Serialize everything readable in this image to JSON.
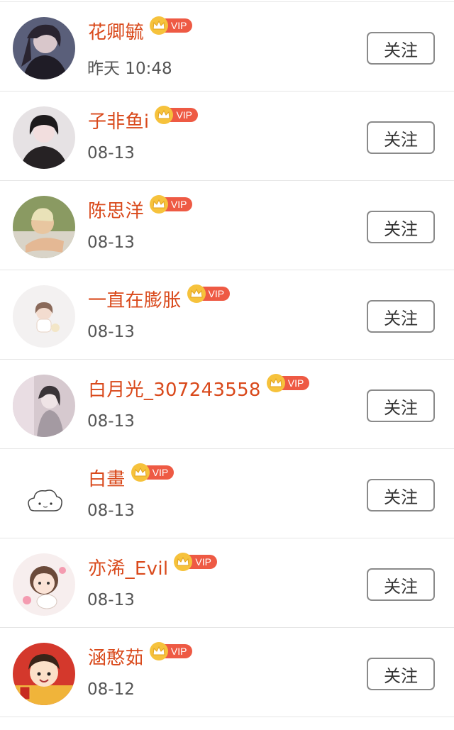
{
  "users": [
    {
      "name": "花卿毓",
      "time": "昨天 10:48",
      "vip": "VIP",
      "follow": "关注",
      "avatar": "avatar-1"
    },
    {
      "name": "子非鱼i",
      "time": "08-13",
      "vip": "VIP",
      "follow": "关注",
      "avatar": "avatar-2"
    },
    {
      "name": "陈思洋",
      "time": "08-13",
      "vip": "VIP",
      "follow": "关注",
      "avatar": "avatar-3"
    },
    {
      "name": "一直在膨胀",
      "time": "08-13",
      "vip": "VIP",
      "follow": "关注",
      "avatar": "avatar-4"
    },
    {
      "name": "白月光_307243558",
      "time": "08-13",
      "vip": "VIP",
      "follow": "关注",
      "avatar": "avatar-5"
    },
    {
      "name": "白畫",
      "time": "08-13",
      "vip": "VIP",
      "follow": "关注",
      "avatar": "avatar-6"
    },
    {
      "name": "亦浠_Evil",
      "time": "08-13",
      "vip": "VIP",
      "follow": "关注",
      "avatar": "avatar-7"
    },
    {
      "name": "涵憨茹",
      "time": "08-12",
      "vip": "VIP",
      "follow": "关注",
      "avatar": "avatar-8"
    }
  ],
  "colors": {
    "name": "#d9491b",
    "vip_tag": "#ee5a44",
    "vip_crown": "#f6c23c",
    "time": "#555555",
    "divider": "#e6e6e6",
    "button_border": "#8a8a8a"
  },
  "icons": {
    "vip_badge": "crown-icon"
  }
}
